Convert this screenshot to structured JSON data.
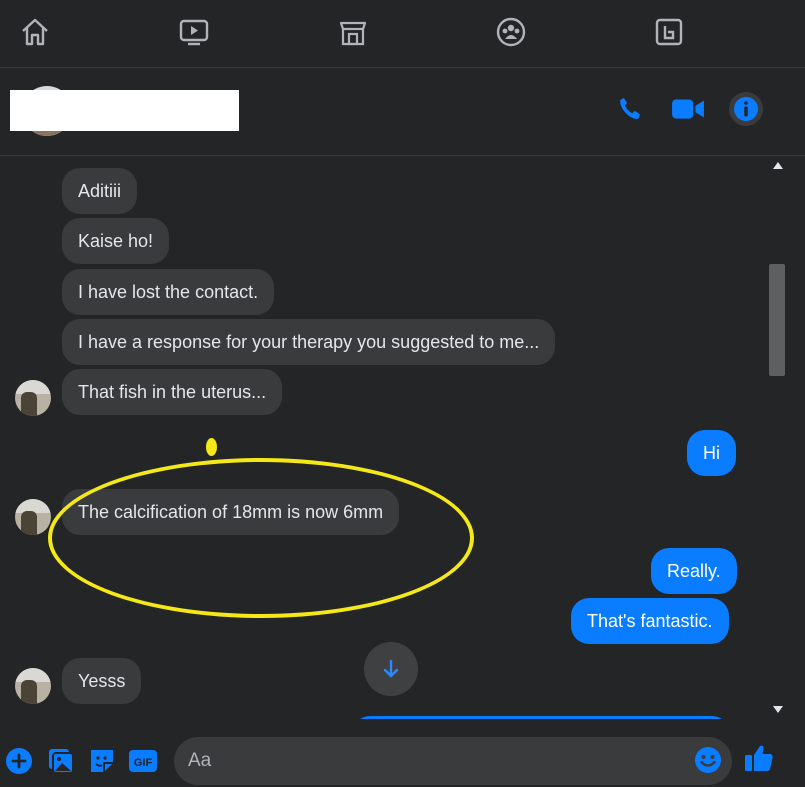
{
  "nav": {
    "items": [
      {
        "icon": "home-icon"
      },
      {
        "icon": "watch-icon"
      },
      {
        "icon": "marketplace-icon"
      },
      {
        "icon": "groups-icon"
      },
      {
        "icon": "gaming-icon"
      }
    ]
  },
  "header": {
    "actions": [
      "phone-icon",
      "video-camera-icon",
      "info-icon"
    ]
  },
  "messages": [
    {
      "from": "them",
      "text": "Aditiii"
    },
    {
      "from": "them",
      "text": "Kaise ho!"
    },
    {
      "from": "them",
      "text": "I have lost the contact."
    },
    {
      "from": "them",
      "text": "I have a response for your therapy you suggested to me..."
    },
    {
      "from": "them",
      "text": "That fish in the uterus..."
    },
    {
      "from": "me",
      "text": "Hi"
    },
    {
      "from": "them",
      "text": "The calcification of 18mm is now 6mm"
    },
    {
      "from": "me",
      "text": "Really."
    },
    {
      "from": "me",
      "text": "That's fantastic."
    },
    {
      "from": "them",
      "text": "Yesss"
    }
  ],
  "composer": {
    "placeholder": "Aa",
    "tools": [
      "plus-icon",
      "image-icon",
      "sticker-icon",
      "gif-icon"
    ],
    "send_icon": "thumbs-up-icon"
  },
  "colors": {
    "accent": "#0a7cff",
    "incoming_bubble": "#3a3b3c",
    "background": "#242526",
    "annotation": "#f5e818"
  }
}
